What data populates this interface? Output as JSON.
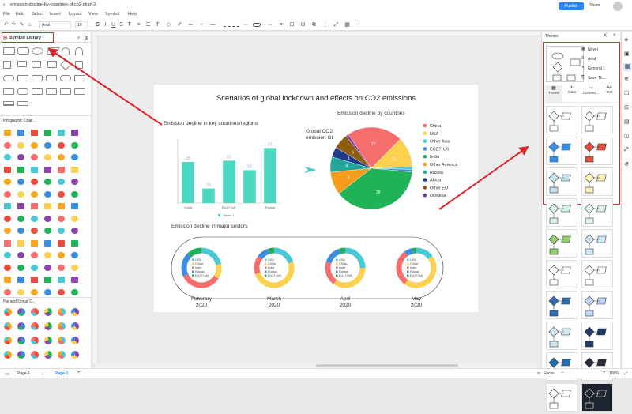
{
  "file": {
    "title": "emission-decline-by-countries-of-co2-chart-2"
  },
  "header": {
    "publish": "Publish",
    "share": "Share"
  },
  "menu": [
    "File",
    "Edit",
    "Select",
    "Insert",
    "Layout",
    "View",
    "Symbol",
    "Help"
  ],
  "toolbar": {
    "font": "Arial",
    "size": "10"
  },
  "library": {
    "title": "Symbol Library",
    "section1": "Infographic Char...",
    "section2": "Pie and Donut C..."
  },
  "theme_panel": {
    "title": "Theme",
    "options": [
      "Novel",
      "Arial",
      "General 1",
      "Save Th..."
    ],
    "tabs": [
      "Theme",
      "Color",
      "Connect...",
      "Text"
    ]
  },
  "status": {
    "page_tab": "Page-1",
    "page_current": "Page-1",
    "focus": "Focus",
    "zoom": "100%"
  },
  "canvas": {
    "title": "Scenarios of global lockdown and effects on CO2 emissions",
    "bar_subtitle": "Emission decline in key countries/regions",
    "pie_subtitle": "Emission decline by countries",
    "pie_side_label": "Global CO2 emission Gt",
    "bar_series": "Series 1",
    "sectors_subtitle": "Emission decline in major sectors",
    "donut_labels": [
      "Feburary 2020",
      "March 2020",
      "April 2020",
      "May 2020"
    ],
    "donut_legend": [
      "USA",
      "China",
      "India",
      "Russia",
      "EU27+UK"
    ]
  },
  "chart_data": [
    {
      "type": "bar",
      "categories": [
        "China",
        "",
        "EU27+UK",
        "",
        "Russia"
      ],
      "values": [
        65,
        23,
        67,
        52,
        87
      ],
      "ylim": [
        0,
        100
      ],
      "series": [
        {
          "name": "Series 1",
          "values": [
            65,
            23,
            67,
            52,
            87
          ]
        }
      ],
      "color": "#4dd6c0"
    },
    {
      "type": "pie",
      "labels": [
        "China",
        "USA",
        "Other Asia",
        "EU27+UK",
        "India",
        "Other America",
        "Russia",
        "Africa",
        "Other EU",
        "Oceania"
      ],
      "values": [
        22,
        12,
        1,
        1,
        38,
        9,
        6,
        4,
        6,
        1
      ],
      "colors": [
        "#f66d6d",
        "#fdd150",
        "#48c9d5",
        "#3b8de0",
        "#1fb257",
        "#f59d1a",
        "#24a59a",
        "#1d3b8a",
        "#8e5d0f",
        "#7c3aa6"
      ]
    }
  ],
  "colors": {
    "accent": "#2684ff",
    "red": "#e0262b"
  }
}
